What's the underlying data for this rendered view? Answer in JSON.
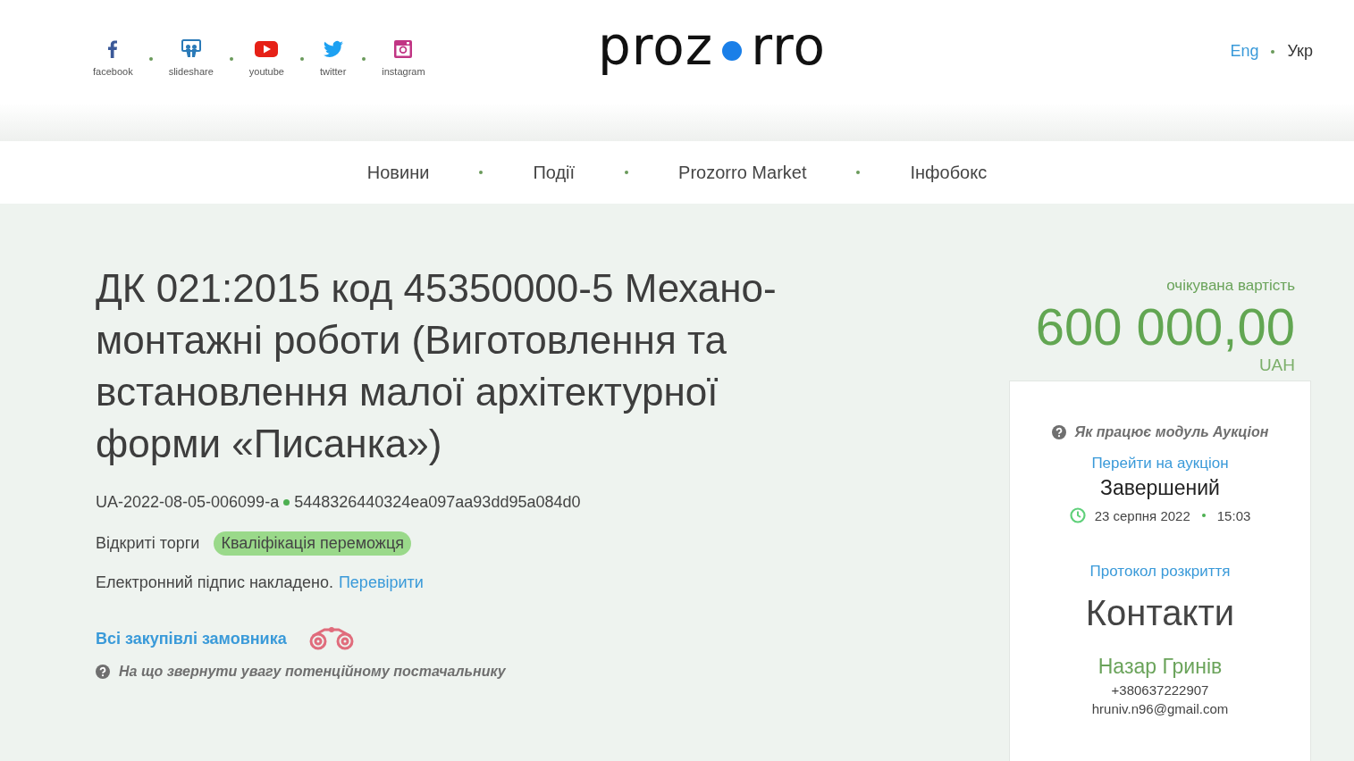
{
  "social_links": [
    {
      "kind": "facebook",
      "label": "facebook"
    },
    {
      "kind": "slideshare",
      "label": "slideshare"
    },
    {
      "kind": "youtube",
      "label": "youtube"
    },
    {
      "kind": "twitter",
      "label": "twitter"
    },
    {
      "kind": "instagram",
      "label": "instagram"
    }
  ],
  "logo": {
    "left": "proz",
    "right": "rro"
  },
  "languages": [
    {
      "label": "Eng",
      "selected": false
    },
    {
      "label": "Укр",
      "selected": true
    }
  ],
  "nav": [
    "Новини",
    "Події",
    "Prozorro Market",
    "Інфобокс"
  ],
  "tender": {
    "title": "ДК 021:2015 код 45350000-5 Механо-монтажні роботи (Виготовлення та встановлення малої архітектурної форми «Писанка»)",
    "id": "UA-2022-08-05-006099-a",
    "hash": "5448326440324ea097aa93dd95a084d0",
    "procedure": "Відкриті торги",
    "status": "Кваліфікація переможця",
    "signature": "Електронний підпис накладено.",
    "verify_link": "Перевірити",
    "buyer_link": "Всі закупівлі замовника",
    "hint": "На що звернути увагу потенційному постачальнику"
  },
  "price": {
    "label": "очікувана вартість",
    "amount": "600 000,00",
    "currency": "UAH"
  },
  "auction": {
    "help": "Як працює модуль Аукціон",
    "link": "Перейти на аукціон",
    "state": "Завершений",
    "date": "23 серпня 2022",
    "time": "15:03"
  },
  "protocol_link": "Протокол розкриття",
  "contacts": {
    "heading": "Контакти",
    "name": "Назар Гринів",
    "phone": "+380637222907",
    "email": "hruniv.n96@gmail.com"
  }
}
